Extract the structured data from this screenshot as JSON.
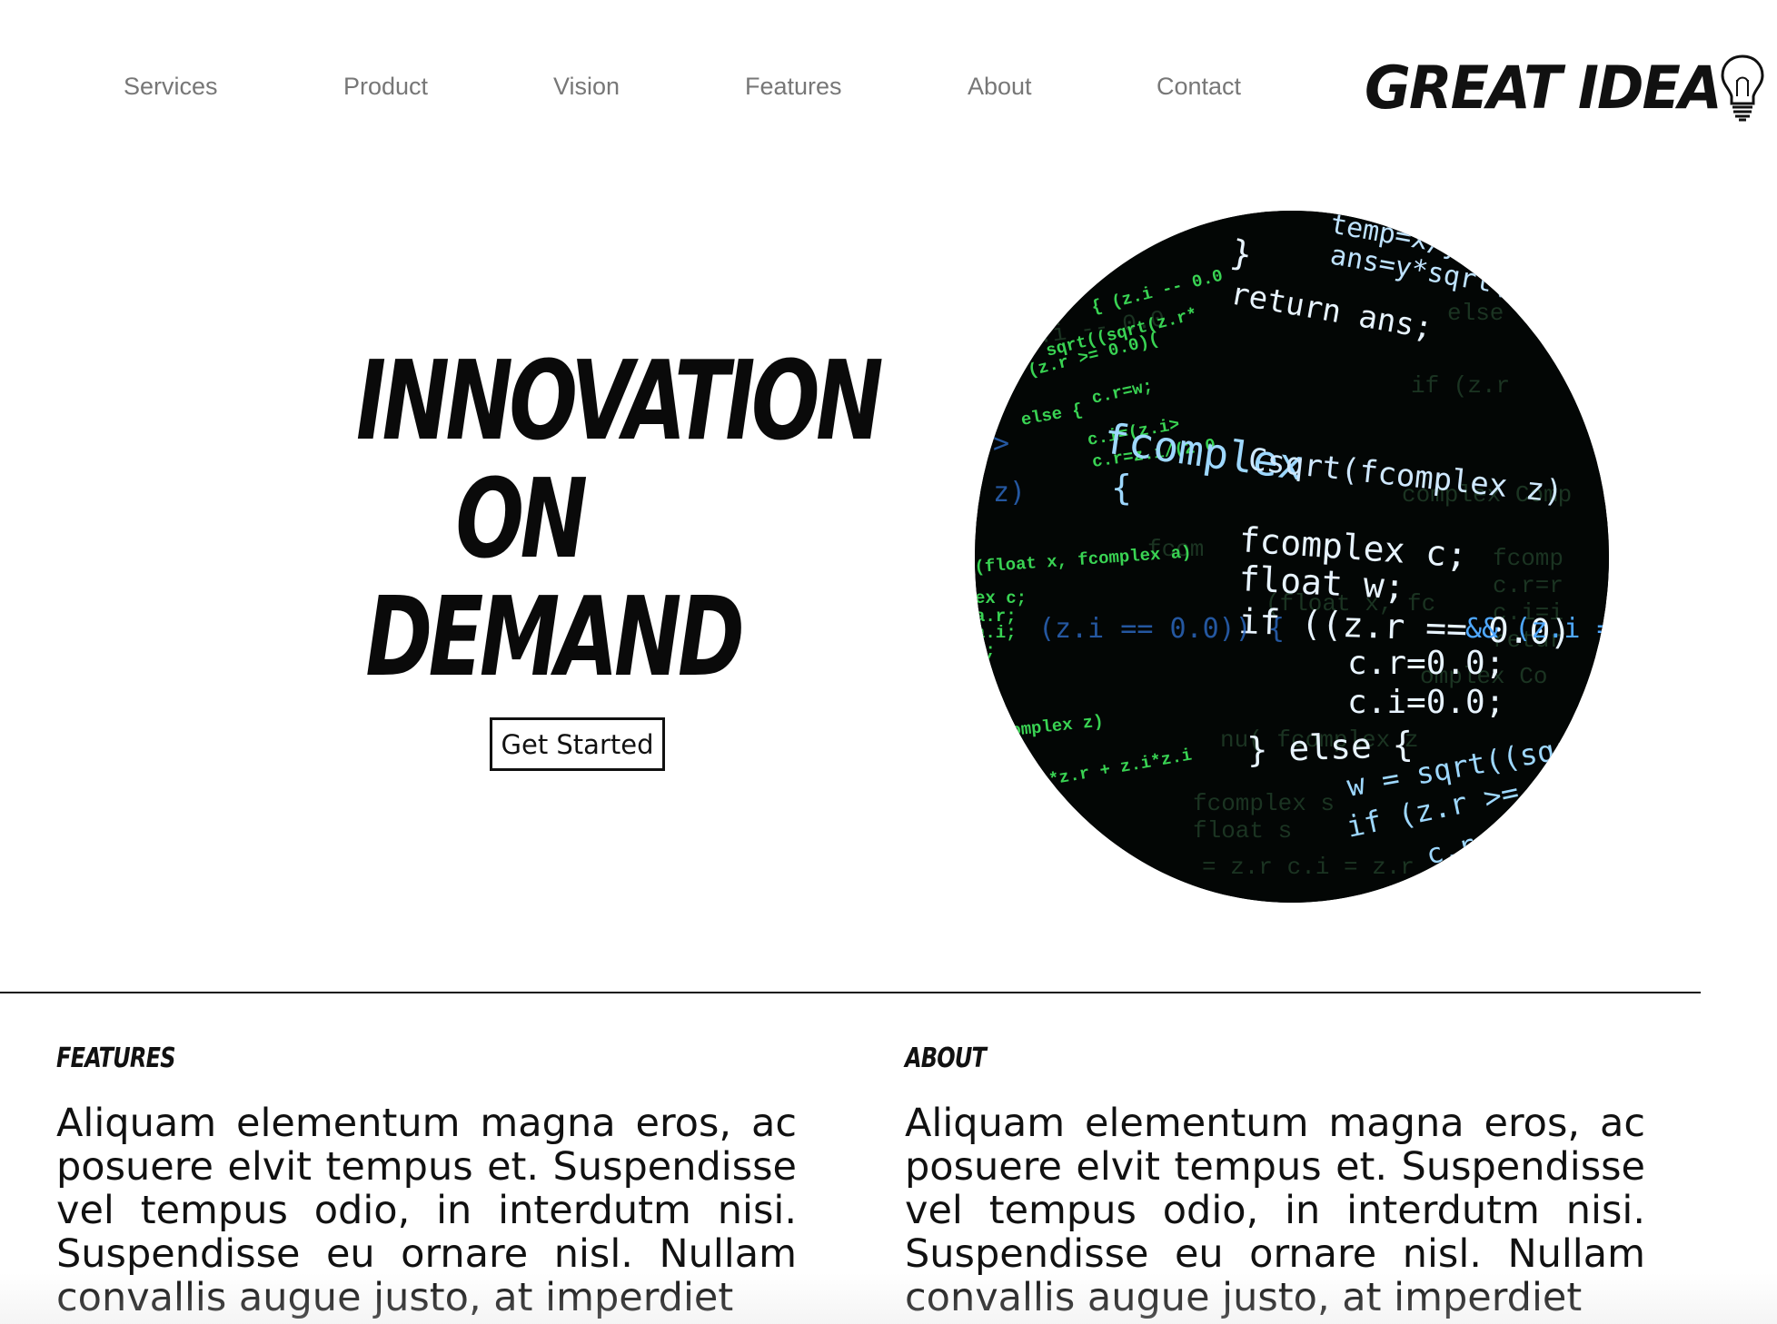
{
  "nav": {
    "items": [
      {
        "label": "Services"
      },
      {
        "label": "Product"
      },
      {
        "label": "Vision"
      },
      {
        "label": "Features"
      },
      {
        "label": "About"
      },
      {
        "label": "Contact"
      }
    ],
    "logo_text": "GREAT IDEA",
    "logo_icon": "lightbulb-icon"
  },
  "hero": {
    "title_lines": [
      "INNOVATION",
      "ON",
      "DEMAND"
    ],
    "cta_label": "Get Started",
    "image_icon": "code-screen-image"
  },
  "sections": [
    {
      "heading": "FEATURES",
      "body": "Aliquam elementum magna eros, ac posuere elvit tempus et. Suspendisse vel tempus odio, in interdutm nisi. Suspendisse eu ornare nisl. Nullam convallis augue justo, at imperdiet"
    },
    {
      "heading": "ABOUT",
      "body": "Aliquam elementum magna eros, ac posuere elvit tempus et. Suspendisse vel tempus odio, in interdutm nisi. Suspendisse eu ornare nisl. Nullam convallis augue justo, at imperdiet"
    }
  ],
  "colors": {
    "nav_text": "#777777",
    "text": "#111111",
    "code_green": "#3ddc5a",
    "code_white": "#e8f4ff",
    "code_blue": "#4fa8ff"
  }
}
